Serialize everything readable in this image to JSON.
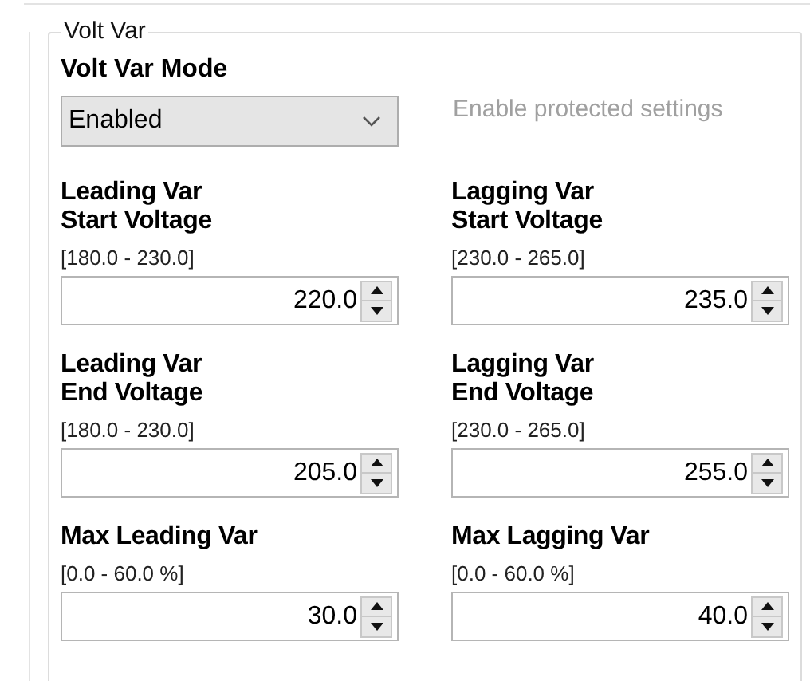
{
  "group": {
    "title": "Volt Var"
  },
  "mode": {
    "label": "Volt Var Mode",
    "value": "Enabled"
  },
  "protected_settings": {
    "label": "Enable protected settings",
    "disabled": true
  },
  "fields": [
    {
      "label": [
        "Leading Var",
        "Start Voltage"
      ],
      "range": "[180.0 - 230.0]",
      "value": "220.0"
    },
    {
      "label": [
        "Lagging Var",
        "Start Voltage"
      ],
      "range": "[230.0 - 265.0]",
      "value": "235.0"
    },
    {
      "label": [
        "Leading Var",
        "End Voltage"
      ],
      "range": "[180.0 - 230.0]",
      "value": "205.0"
    },
    {
      "label": [
        "Lagging Var",
        "End Voltage"
      ],
      "range": "[230.0 - 265.0]",
      "value": "255.0"
    },
    {
      "label": [
        "Max Leading Var"
      ],
      "range": "[0.0 - 60.0 %]",
      "value": "30.0"
    },
    {
      "label": [
        "Max Lagging Var"
      ],
      "range": "[0.0 - 60.0 %]",
      "value": "40.0"
    }
  ]
}
